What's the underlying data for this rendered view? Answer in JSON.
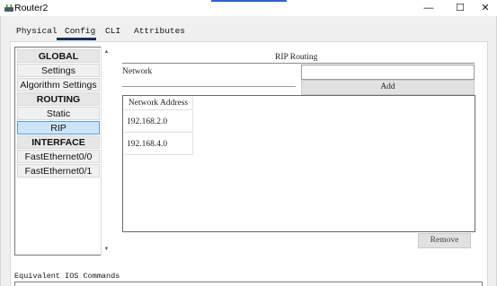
{
  "window": {
    "title": "Router2",
    "minimize_glyph": "—",
    "maximize_glyph": "☐",
    "close_glyph": "✕"
  },
  "tabs": [
    {
      "label": "Physical",
      "selected": false
    },
    {
      "label": "Config",
      "selected": true
    },
    {
      "label": "CLI",
      "selected": false
    },
    {
      "label": "Attributes",
      "selected": false
    }
  ],
  "sidebar": {
    "items": [
      {
        "label": "GLOBAL",
        "type": "header"
      },
      {
        "label": "Settings",
        "type": "item"
      },
      {
        "label": "Algorithm Settings",
        "type": "item"
      },
      {
        "label": "ROUTING",
        "type": "header"
      },
      {
        "label": "Static",
        "type": "item"
      },
      {
        "label": "RIP",
        "type": "item",
        "selected": true
      },
      {
        "label": "INTERFACE",
        "type": "header"
      },
      {
        "label": "FastEthernet0/0",
        "type": "item"
      },
      {
        "label": "FastEthernet0/1",
        "type": "item"
      }
    ],
    "scroll_up_glyph": "▲",
    "scroll_down_glyph": "▼"
  },
  "rip": {
    "title": "RIP Routing",
    "network_label": "Network",
    "network_value": "",
    "add_label": "Add",
    "table_header": "Network Address",
    "networks": [
      "192.168.2.0",
      "192.168.4.0"
    ],
    "remove_label": "Remove"
  },
  "equivalent": {
    "label": "Equivalent IOS Commands"
  },
  "colors": {
    "selected_item": "#cce4f7",
    "tab_underline": "#1a2f5c",
    "accent": "#2b63d6"
  }
}
